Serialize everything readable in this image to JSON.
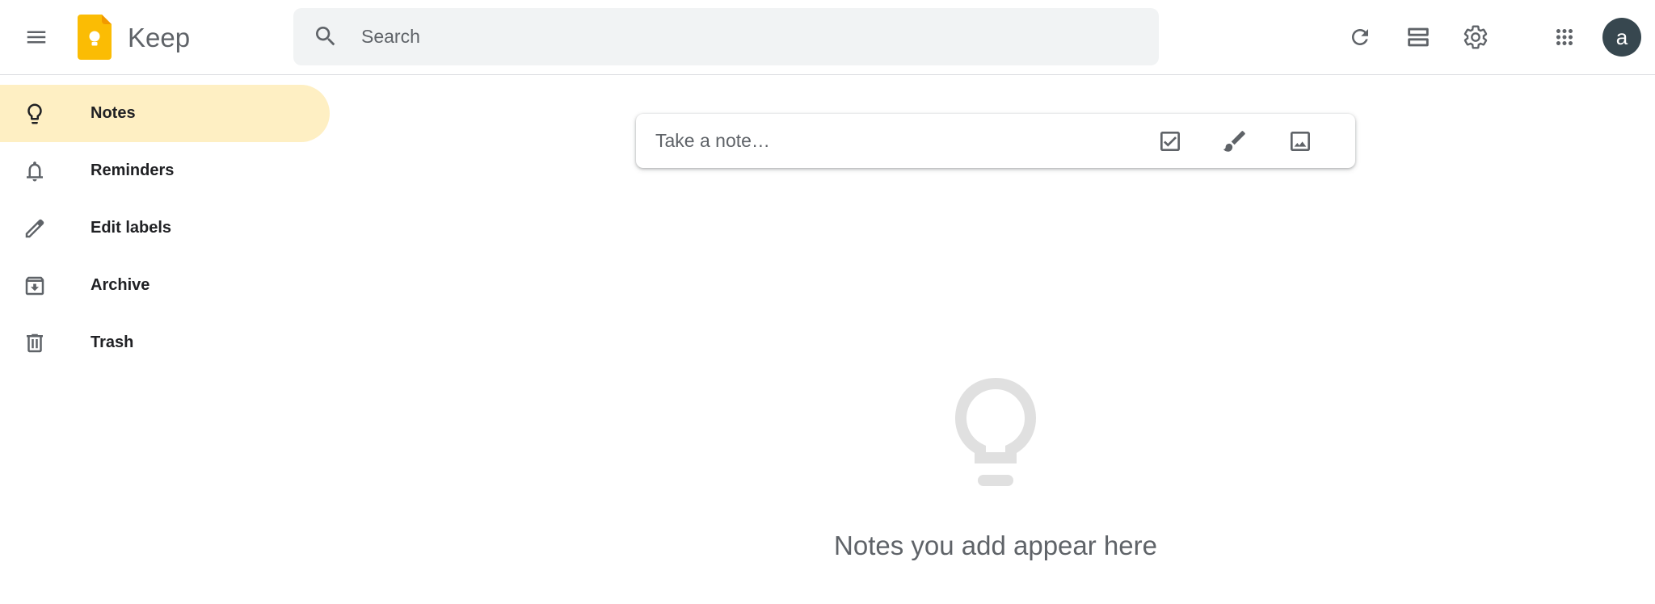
{
  "header": {
    "app_title": "Keep",
    "menu_icon": "hamburger-menu-icon",
    "logo_icon": "keep-logo-icon",
    "search": {
      "placeholder": "Search",
      "value": ""
    },
    "actions": [
      "refresh-icon",
      "list-view-icon",
      "settings-gear-icon",
      "google-apps-icon"
    ],
    "avatar_letter": "a"
  },
  "sidebar": {
    "items": [
      {
        "label": "Notes",
        "icon": "lightbulb-icon",
        "active": true
      },
      {
        "label": "Reminders",
        "icon": "bell-icon",
        "active": false
      },
      {
        "label": "Edit labels",
        "icon": "pencil-icon",
        "active": false
      },
      {
        "label": "Archive",
        "icon": "archive-icon",
        "active": false
      },
      {
        "label": "Trash",
        "icon": "trash-icon",
        "active": false
      }
    ]
  },
  "main": {
    "take_note": {
      "placeholder": "Take a note…",
      "buttons": [
        "checkbox-icon",
        "brush-icon",
        "image-icon"
      ]
    },
    "empty_state": {
      "icon": "lightbulb-outline-icon",
      "message": "Notes you add appear here"
    }
  },
  "colors": {
    "active_nav": "#feefc3",
    "logo_yellow": "#fbbc04",
    "search_bg": "#f1f3f4",
    "avatar_bg": "#37474f",
    "muted_text": "#5f6368",
    "empty_icon": "#e0e0e0"
  }
}
